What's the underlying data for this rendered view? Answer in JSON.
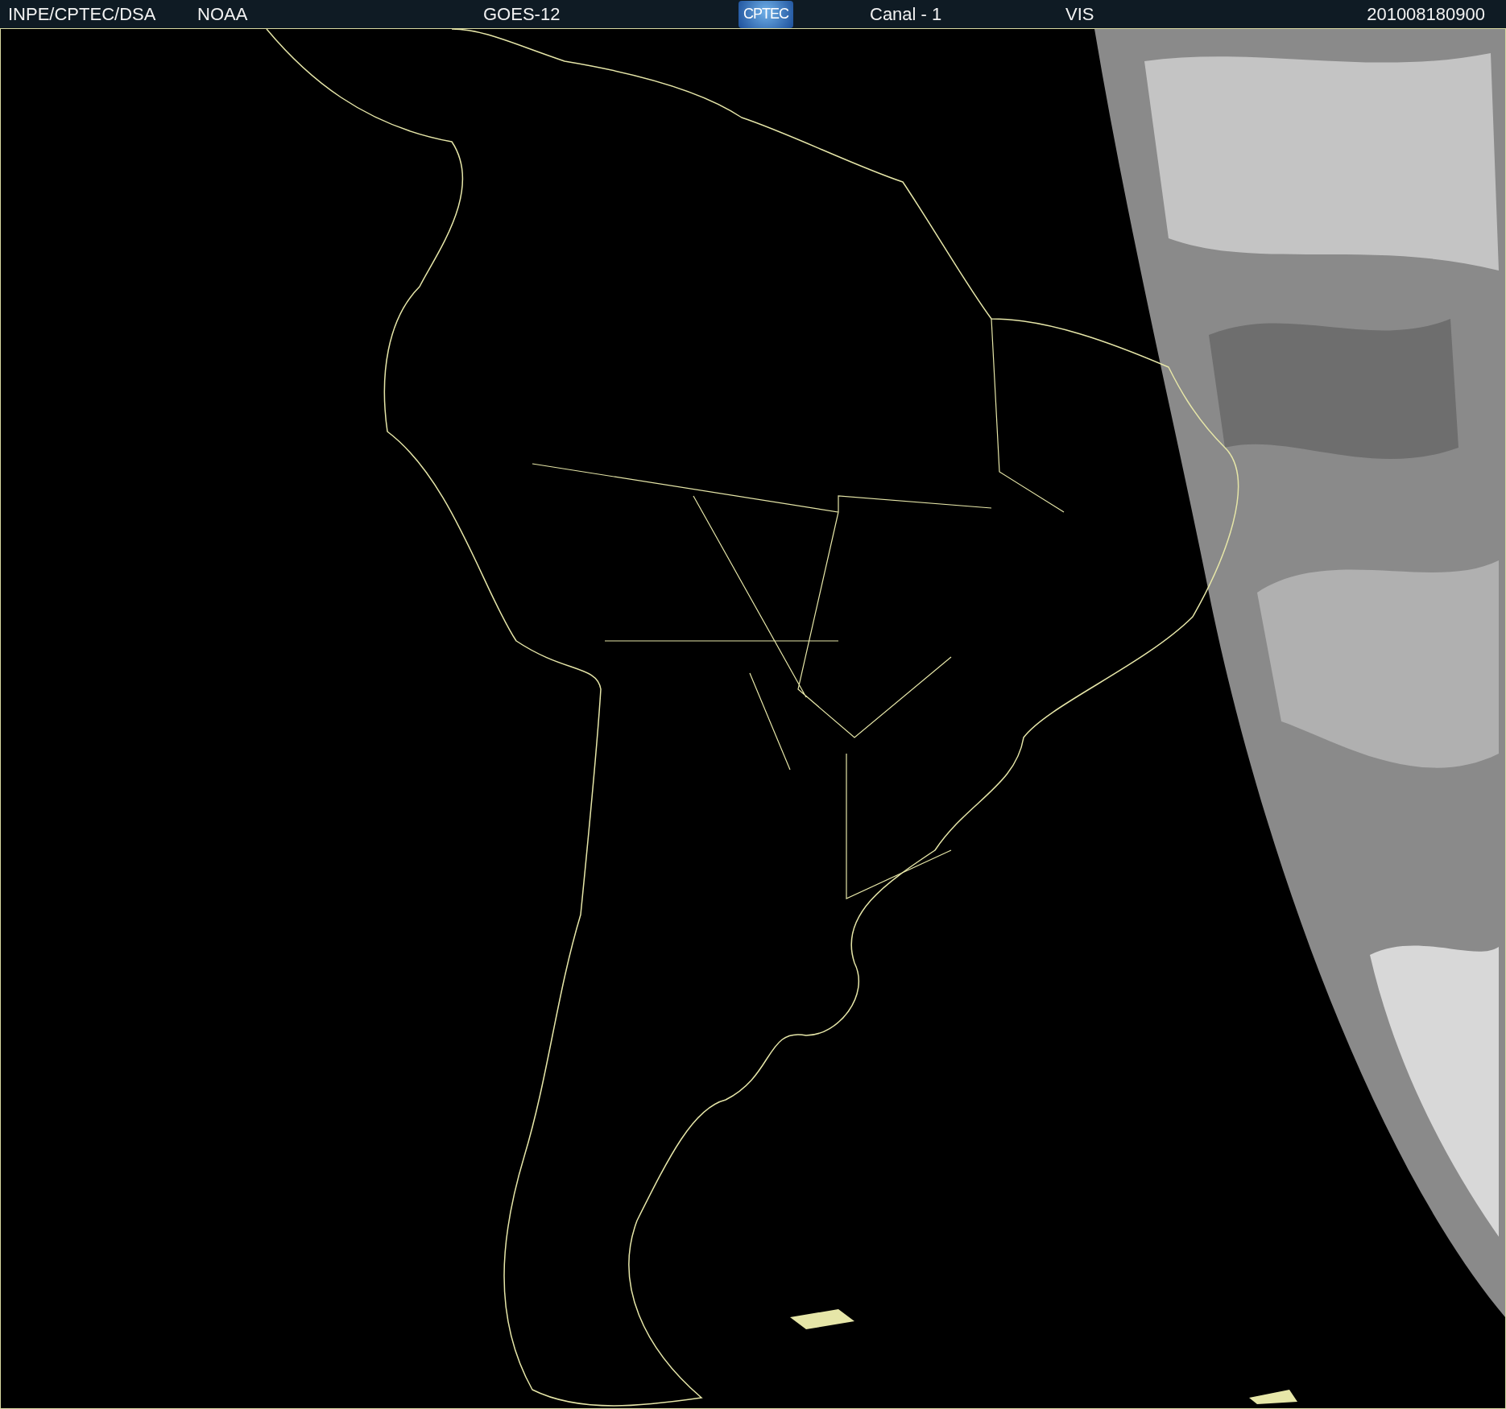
{
  "header": {
    "source": "INPE/CPTEC/DSA",
    "agency": "NOAA",
    "satellite": "GOES-12",
    "logo": "CPTEC",
    "channel": "Canal - 1",
    "band": "VIS",
    "timestamp": "201008180900"
  }
}
